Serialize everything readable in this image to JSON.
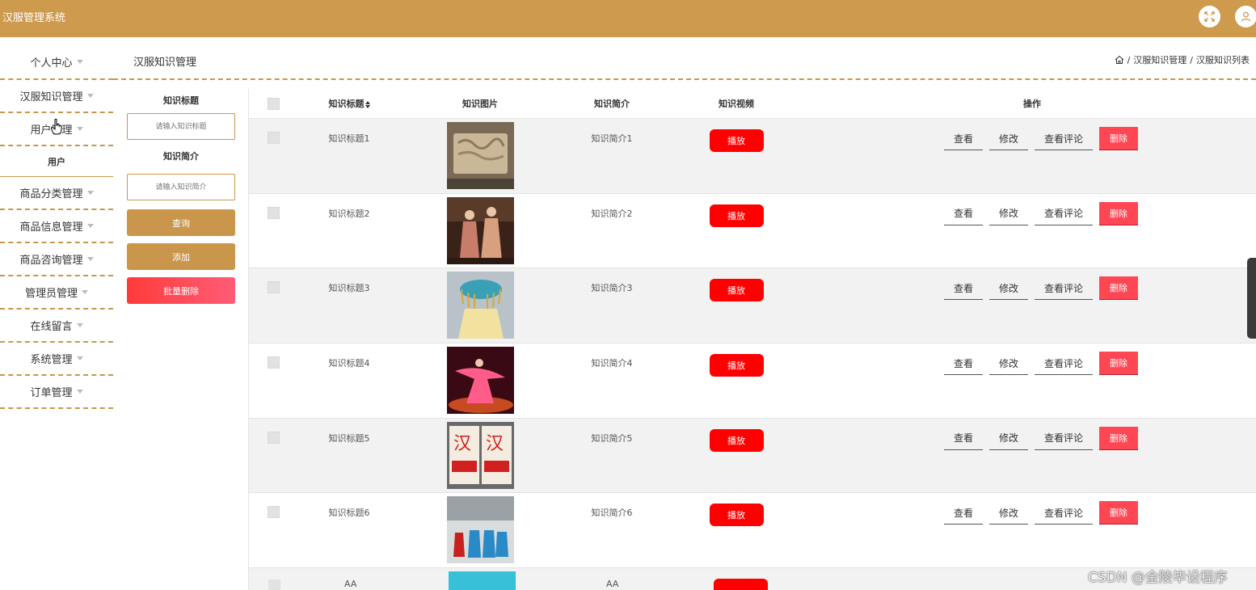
{
  "app": {
    "title": "汉服管理系统"
  },
  "header": {
    "fullscreen_icon": "fullscreen-icon",
    "user_icon": "user-icon"
  },
  "sidebar": {
    "items": [
      {
        "label": "个人中心"
      },
      {
        "label": "汉服知识管理"
      },
      {
        "label": "用户管理",
        "sub": "用户"
      },
      {
        "label": "商品分类管理"
      },
      {
        "label": "商品信息管理"
      },
      {
        "label": "商品咨询管理"
      },
      {
        "label": "管理员管理"
      },
      {
        "label": "在线留言"
      },
      {
        "label": "系统管理"
      },
      {
        "label": "订单管理"
      }
    ]
  },
  "page": {
    "title": "汉服知识管理",
    "breadcrumb": [
      "汉服知识管理",
      "汉服知识列表"
    ]
  },
  "search": {
    "title_label": "知识标题",
    "title_placeholder": "请输入知识标题",
    "intro_label": "知识简介",
    "intro_placeholder": "请输入知识简介",
    "query_btn": "查询",
    "add_btn": "添加",
    "batch_delete_btn": "批量删除"
  },
  "table": {
    "headers": {
      "title": "知识标题",
      "image": "知识图片",
      "intro": "知识简介",
      "video": "知识视频",
      "ops": "操作"
    },
    "rows": [
      {
        "title": "知识标题1",
        "intro": "知识简介1"
      },
      {
        "title": "知识标题2",
        "intro": "知识简介2"
      },
      {
        "title": "知识标题3",
        "intro": "知识简介3"
      },
      {
        "title": "知识标题4",
        "intro": "知识简介4"
      },
      {
        "title": "知识标题5",
        "intro": "知识简介5"
      },
      {
        "title": "知识标题6",
        "intro": "知识简介6"
      }
    ],
    "partial_row": {
      "title": "AA",
      "intro": "AA"
    },
    "play_label": "播放",
    "ops": {
      "view": "查看",
      "edit": "修改",
      "comments": "查看评论",
      "delete": "删除"
    }
  },
  "watermark": "CSDN @金陵毕设程序",
  "colors": {
    "brand": "#cd9a4e",
    "danger": "#ff0000",
    "delete": "#ff4754"
  }
}
